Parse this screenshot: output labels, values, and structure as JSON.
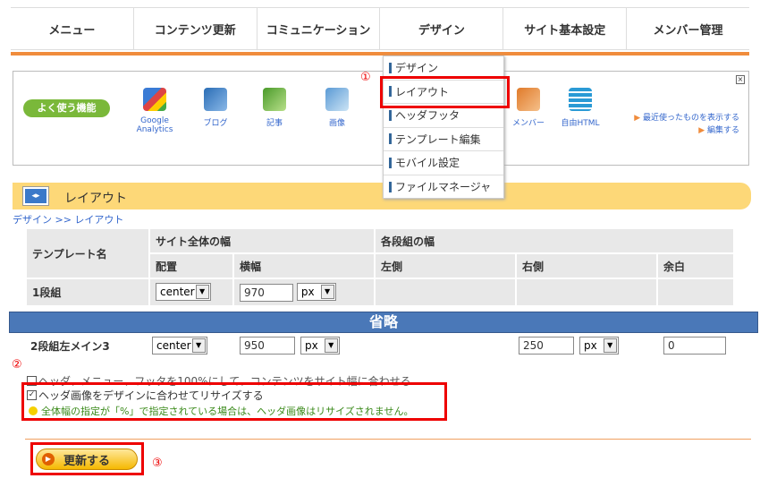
{
  "topnav": {
    "items": [
      "メニュー",
      "コンテンツ更新",
      "コミュニケーション",
      "デザイン",
      "サイト基本設定",
      "メンバー管理"
    ]
  },
  "quick": {
    "label": "よく使う機能",
    "icons": [
      {
        "label": "Google Analytics",
        "icon": "google-analytics-icon"
      },
      {
        "label": "ブログ",
        "icon": "blog-icon"
      },
      {
        "label": "記事",
        "icon": "article-icon"
      },
      {
        "label": "画像",
        "icon": "image-icon"
      },
      {
        "label": "メンバー",
        "icon": "members-icon"
      },
      {
        "label": "自由HTML",
        "icon": "free-html-icon"
      }
    ],
    "recent_label": "最近使ったものを表示する",
    "edit_label": "編集する",
    "close": "×"
  },
  "dropdown": {
    "items": [
      "デザイン",
      "レイアウト",
      "ヘッダフッタ",
      "テンプレート編集",
      "モバイル設定",
      "ファイルマネージャ"
    ]
  },
  "annotations": {
    "n1": "①",
    "n2": "②",
    "n3": "③"
  },
  "section": {
    "title": "レイアウト",
    "icon_text": "◂▸"
  },
  "breadcrumb": "デザイン >> レイアウト",
  "table": {
    "col_template": "テンプレート名",
    "col_site_width": "サイト全体の幅",
    "col_stage_width": "各段組の幅",
    "sub_align": "配置",
    "sub_width": "横幅",
    "sub_left": "左側",
    "sub_right": "右側",
    "sub_margin": "余白",
    "row1": {
      "name": "1段組",
      "align": "center",
      "width": "970",
      "unit": "px"
    },
    "row2": {
      "name": "2段組左メイン3",
      "align": "center",
      "width": "950",
      "unit": "px",
      "right": "250",
      "right_unit": "px",
      "margin": "0"
    }
  },
  "banner": "省略",
  "options": {
    "opt1": "ヘッダ、メニュー、フッタを100%にして、コンテンツをサイト幅に合わせる",
    "opt2": "ヘッダ画像をデザインに合わせてリサイズする",
    "note": "全体幅の指定が「%」で指定されている場合は、ヘッダ画像はリサイズされません。"
  },
  "update_button": "更新する"
}
